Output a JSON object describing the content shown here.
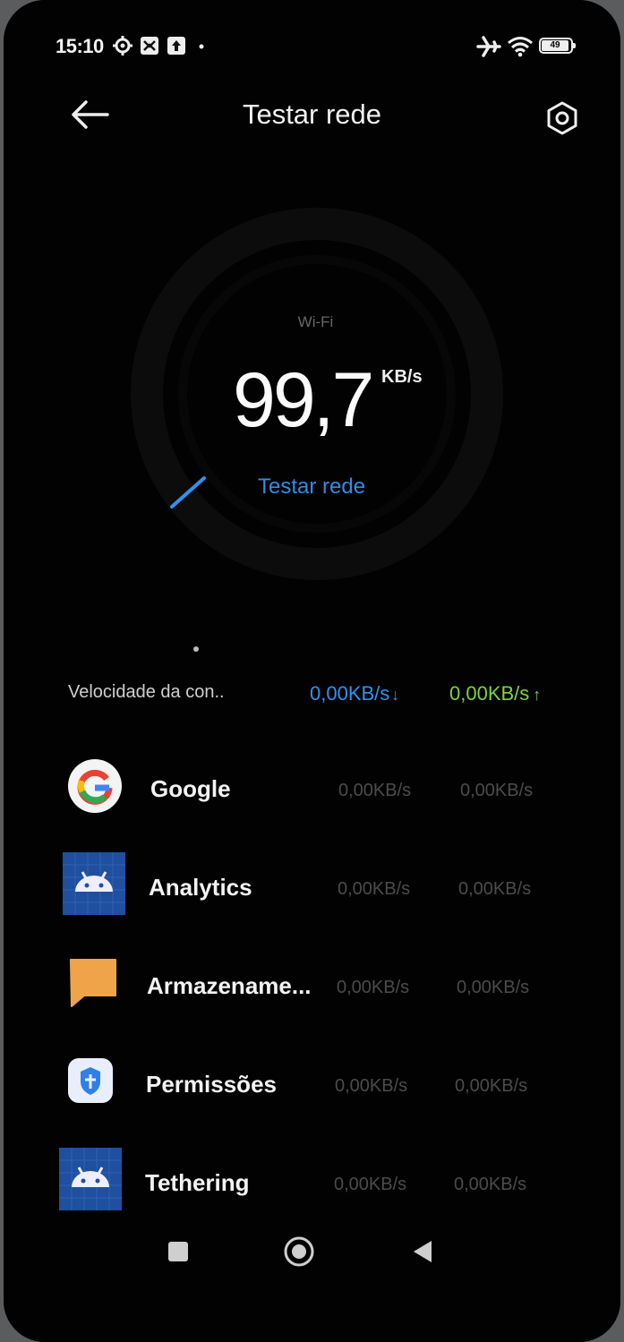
{
  "status_bar": {
    "time": "15:10",
    "battery": "49",
    "icons": [
      "settings-gear-icon",
      "shopping-bag-icon",
      "upload-icon",
      "dot-icon",
      "airplane-icon",
      "wifi-icon",
      "battery-icon"
    ]
  },
  "header": {
    "title": "Testar rede",
    "back_icon": "back-arrow-icon",
    "settings_icon": "settings-hex-icon"
  },
  "speed_test": {
    "network_type": "Wi-Fi",
    "value": "99,7",
    "unit": "KB/s",
    "button_label": "Testar rede"
  },
  "connection": {
    "label": "Velocidade da con..",
    "download": "0,00KB/s",
    "download_arrow": "↓",
    "upload": "0,00KB/s",
    "upload_arrow": "↑",
    "download_color": "#2f93ee",
    "upload_color": "#7dd43a"
  },
  "apps": [
    {
      "name": "Google",
      "down": "0,00KB/s",
      "up": "0,00KB/s",
      "icon": "google-icon"
    },
    {
      "name": "Analytics",
      "down": "0,00KB/s",
      "up": "0,00KB/s",
      "icon": "android-icon"
    },
    {
      "name": "Armazename...",
      "down": "0,00KB/s",
      "up": "0,00KB/s",
      "icon": "chat-bubble-icon"
    },
    {
      "name": "Permissões",
      "down": "0,00KB/s",
      "up": "0,00KB/s",
      "icon": "shield-icon"
    },
    {
      "name": "Tethering",
      "down": "0,00KB/s",
      "up": "0,00KB/s",
      "icon": "android-icon"
    }
  ],
  "navigation": {
    "icons": [
      "recents-square-icon",
      "home-circle-icon",
      "back-triangle-icon"
    ]
  }
}
